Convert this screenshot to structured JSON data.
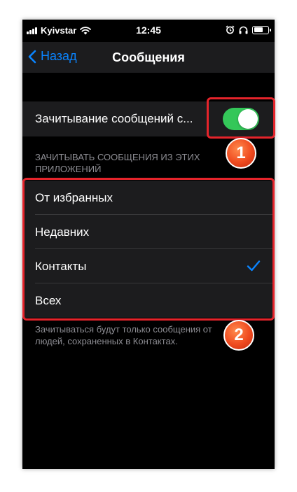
{
  "status_bar": {
    "carrier": "Kyivstar",
    "time": "12:45",
    "icons": [
      "signal-bars-icon",
      "wifi-icon",
      "alarm-icon",
      "headphones-icon",
      "battery-icon"
    ]
  },
  "nav": {
    "back_label": "Назад",
    "title": "Сообщения"
  },
  "toggle_row": {
    "label": "Зачитывание сообщений с...",
    "on": true,
    "color_on": "#34c759"
  },
  "section": {
    "header": "ЗАЧИТЫВАТЬ СООБЩЕНИЯ ИЗ ЭТИХ ПРИЛОЖЕНИЙ"
  },
  "options": [
    {
      "label": "От избранных",
      "selected": false
    },
    {
      "label": "Недавних",
      "selected": false
    },
    {
      "label": "Контакты",
      "selected": true
    },
    {
      "label": "Всех",
      "selected": false
    }
  ],
  "footer": {
    "note": "Зачитываться будут только сообщения от людей, сохраненных в Контактах."
  },
  "annotations": {
    "badge_1": "1",
    "badge_2": "2",
    "highlight_color": "#e5242b"
  },
  "colors": {
    "accent": "#0a84ff",
    "background": "#000000",
    "cell": "#1c1c1e"
  }
}
